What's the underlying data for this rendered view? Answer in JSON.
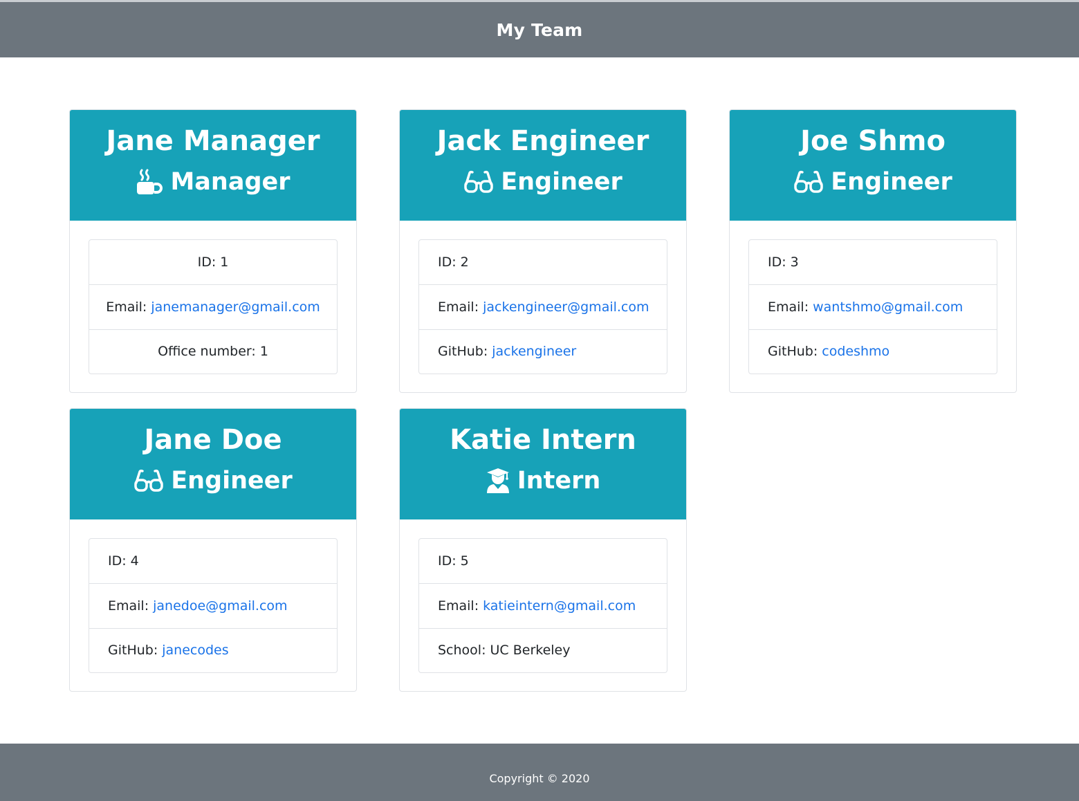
{
  "header": {
    "title": "My Team"
  },
  "cards": [
    {
      "name": "Jane Manager",
      "role": "Manager",
      "role_icon": "coffee-icon",
      "id_line": "ID: 1",
      "email_label": "Email:",
      "email": "janemanager@gmail.com",
      "extra_label": "Office number: 1",
      "extra_link": ""
    },
    {
      "name": "Jack Engineer",
      "role": "Engineer",
      "role_icon": "glasses-icon",
      "id_line": "ID: 2",
      "email_label": "Email:",
      "email": "jackengineer@gmail.com",
      "extra_label": "GitHub:",
      "extra_link": "jackengineer"
    },
    {
      "name": "Joe Shmo",
      "role": "Engineer",
      "role_icon": "glasses-icon",
      "id_line": "ID: 3",
      "email_label": "Email:",
      "email": "wantshmo@gmail.com",
      "extra_label": "GitHub:",
      "extra_link": "codeshmo"
    },
    {
      "name": "Jane Doe",
      "role": "Engineer",
      "role_icon": "glasses-icon",
      "id_line": "ID: 4",
      "email_label": "Email:",
      "email": "janedoe@gmail.com",
      "extra_label": "GitHub:",
      "extra_link": "janecodes"
    },
    {
      "name": "Katie Intern",
      "role": "Intern",
      "role_icon": "graduate-icon",
      "id_line": "ID: 5",
      "email_label": "Email:",
      "email": "katieintern@gmail.com",
      "extra_label": "School: UC Berkeley",
      "extra_link": ""
    }
  ],
  "footer": {
    "text": "Copyright © 2020"
  },
  "colors": {
    "header_bg": "#6c757d",
    "card_head_bg": "#17a2b8",
    "link": "#1a73e8"
  }
}
